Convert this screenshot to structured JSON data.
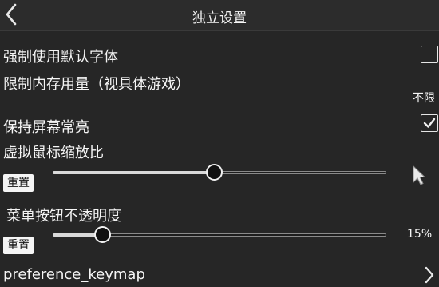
{
  "header": {
    "title": "独立设置",
    "back_icon": "chevron-left-icon"
  },
  "settings": {
    "force_default_font": {
      "label": "强制使用默认字体",
      "checked": false
    },
    "memory_limit": {
      "label": "限制内存用量（视具体游戏）",
      "value": "不限"
    },
    "keep_screen_on": {
      "label": "保持屏幕常亮",
      "checked": true
    },
    "virtual_mouse_scale": {
      "label": "虚拟鼠标缩放比",
      "reset_label": "重置",
      "level": 0.5,
      "preview_icon": "mouse-cursor-icon"
    },
    "menu_button_opacity": {
      "label": "菜单按钮不透明度",
      "reset_label": "重置",
      "value": "15%",
      "level": 0.15
    },
    "preference_keymap": {
      "label": "preference_keymap",
      "chevron_icon": "chevron-right-icon"
    }
  },
  "colors": {
    "background": "#262626",
    "text": "#f5f5f5"
  }
}
